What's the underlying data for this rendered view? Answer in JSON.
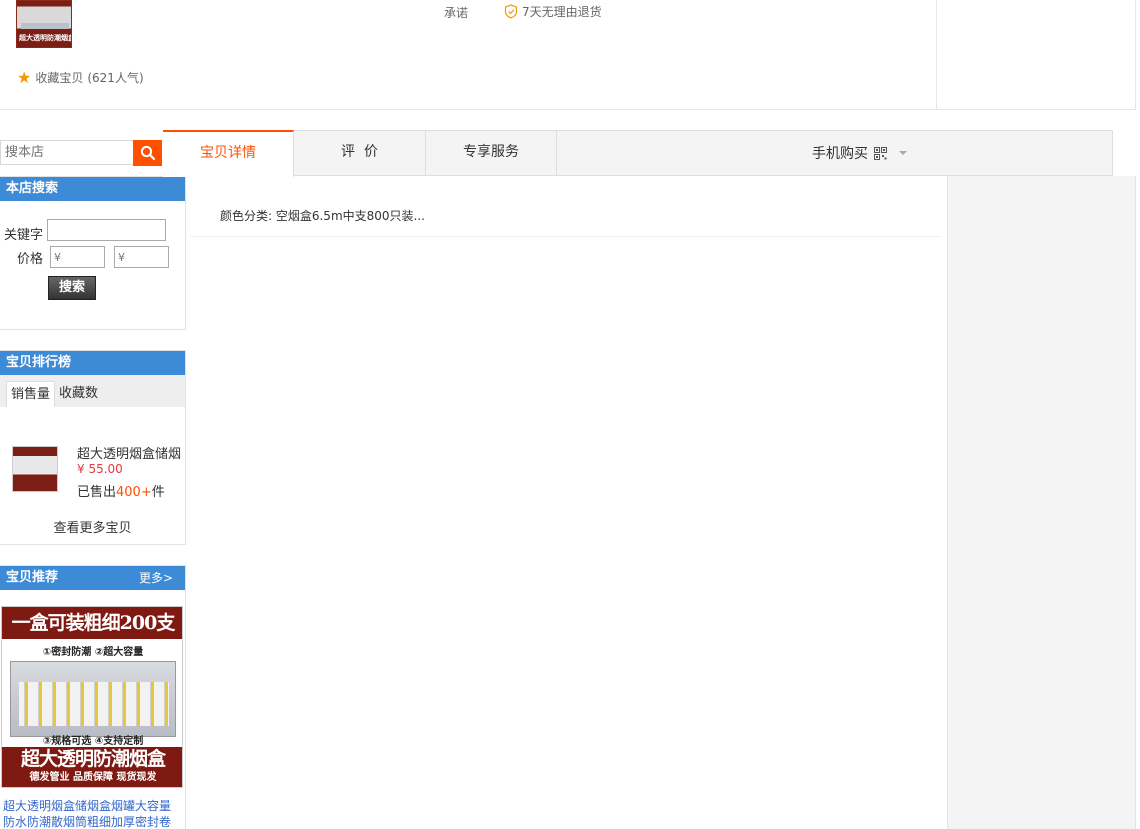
{
  "product_top": {
    "thumb_text": "超大透明防潮烟盒",
    "favorite_label": "收藏宝贝",
    "favorite_count": "(621人气)",
    "promise_label": "承诺",
    "promise_item": "7天无理由退货"
  },
  "shop_search": {
    "placeholder": "搜本店"
  },
  "search_box": {
    "title": "本店搜索",
    "keyword_label": "关键字",
    "price_label": "价格",
    "price_min_placeholder": "¥",
    "price_max_placeholder": "¥",
    "submit_label": "搜索"
  },
  "ranking": {
    "title": "宝贝排行榜",
    "tabs": [
      "销售量",
      "收藏数"
    ],
    "item": {
      "title": "超大透明烟盒储烟",
      "price": "¥ 55.00",
      "sold_prefix": "已售出",
      "sold_count": "400+",
      "sold_suffix": "件"
    },
    "more_label": "查看更多宝贝"
  },
  "recommend": {
    "title": "宝贝推荐",
    "more_label": "更多>",
    "image_text": {
      "headline": "一盒可装粗细200支",
      "line1": "①密封防潮  ②超大容量",
      "line2": "③规格可选  ④支持定制",
      "banner": "超大透明防潮烟盒",
      "sub": "德发管业  品质保障  现货现发"
    },
    "item_title": "超大透明烟盒储烟盒烟罐大容量防水防潮散烟筒粗细加厚密封卷"
  },
  "tabs": {
    "items": [
      "宝贝详情",
      "评  价",
      "专享服务"
    ],
    "active": "宝贝详情",
    "mobile_buy": "手机购买"
  },
  "details": {
    "attribute": "颜色分类: 空烟盒6.5m中支800只装..."
  },
  "colors": {
    "accent": "#ff5000",
    "sidebar_header": "#3d8bd6",
    "price": "#e4393c"
  }
}
